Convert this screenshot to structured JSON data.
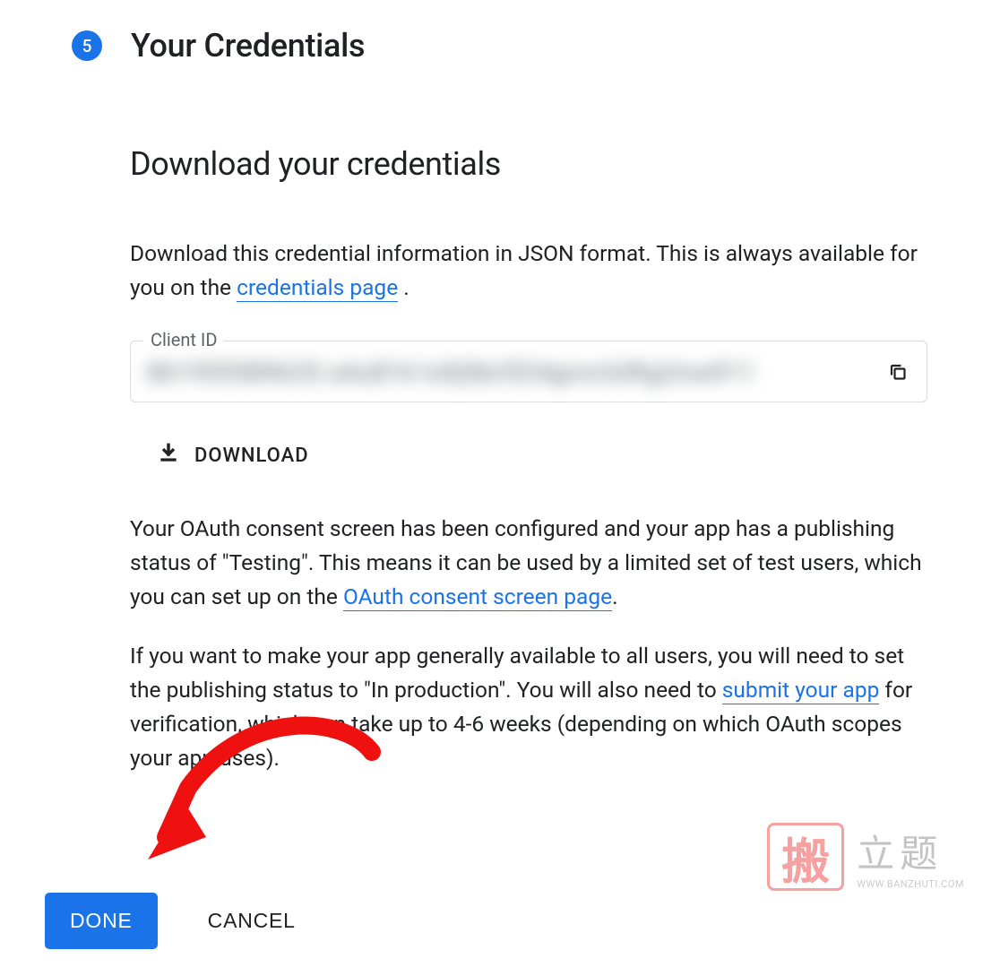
{
  "step": {
    "number": "5",
    "title": "Your Credentials"
  },
  "section": {
    "heading": "Download your credentials",
    "intro_prefix": "Download this credential information in JSON format. This is always available for you on the ",
    "intro_link": "credentials page",
    "intro_suffix": " ."
  },
  "client_id": {
    "label": "Client ID",
    "value_blurred": "86195558962S a4u81k1e9j5brl524gmn2d9g2me911"
  },
  "download": {
    "label": "DOWNLOAD"
  },
  "para2": {
    "p1": "Your OAuth consent screen has been configured and your app has a publishing status of \"Testing\". This means it can be used by a limited set of test users, which you can set up on the ",
    "link1": "OAuth consent screen page",
    "p1_suffix": "."
  },
  "para3": {
    "p1": "If you want to make your app generally available to all users, you will need to set the publishing status to \"In production\". You will also need to ",
    "link1": "submit your app",
    "p2": " for verification, which can take up to 4-6 weeks (depending on which OAuth scopes your app uses)."
  },
  "actions": {
    "done": "DONE",
    "cancel": "CANCEL"
  },
  "watermark": {
    "stamp": "搬",
    "cn": "立题",
    "url": "WWW.BANZHUTI.COM"
  }
}
